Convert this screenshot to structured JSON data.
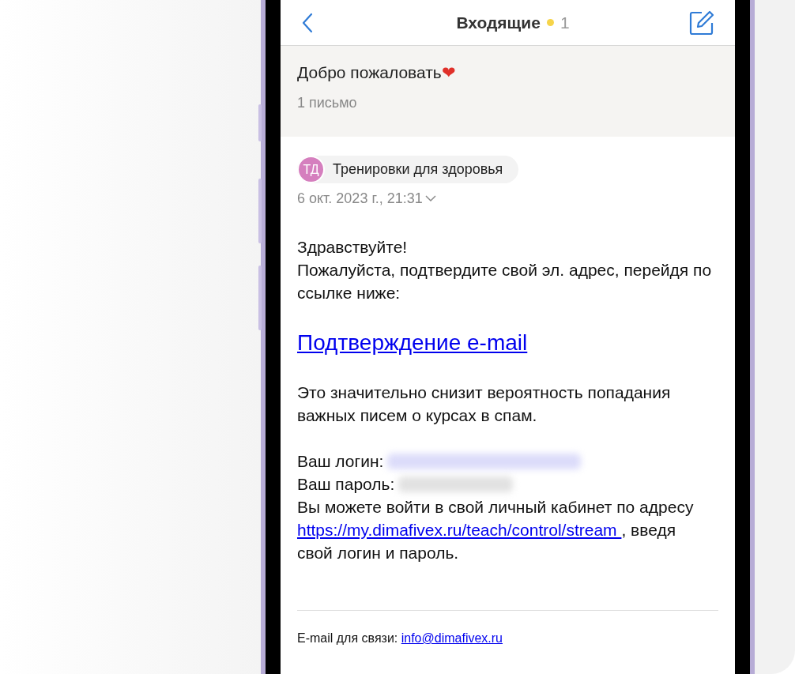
{
  "header": {
    "title": "Входящие",
    "unread_count": "1"
  },
  "thread": {
    "subject": "Добро пожаловать",
    "emoji": "❤",
    "count": "1 письмо"
  },
  "message": {
    "sender_initials": "ТД",
    "sender": "Тренировки для здоровья",
    "date": "6 окт. 2023 г., 21:31",
    "greeting": "Здравствуйте!",
    "intro": "Пожалуйста, подтвердите свой эл. адрес, перейдя по ссылке ниже:",
    "confirm_link": "Подтверждение e-mail ",
    "note": "Это значительно снизит вероятность попадания важных писем о курсах в спам.",
    "login_label": "Ваш логин:",
    "password_label": "Ваш пароль:",
    "cabinet_text": "Вы можете войти в свой личный кабинет по адресу",
    "cabinet_link": "https://my.dimafivex.ru/teach/control/stream ",
    "cabinet_tail": ", введя свой логин и пароль.",
    "footer_label": "E-mail для связи:",
    "footer_link": "info@dimafivex.ru"
  }
}
